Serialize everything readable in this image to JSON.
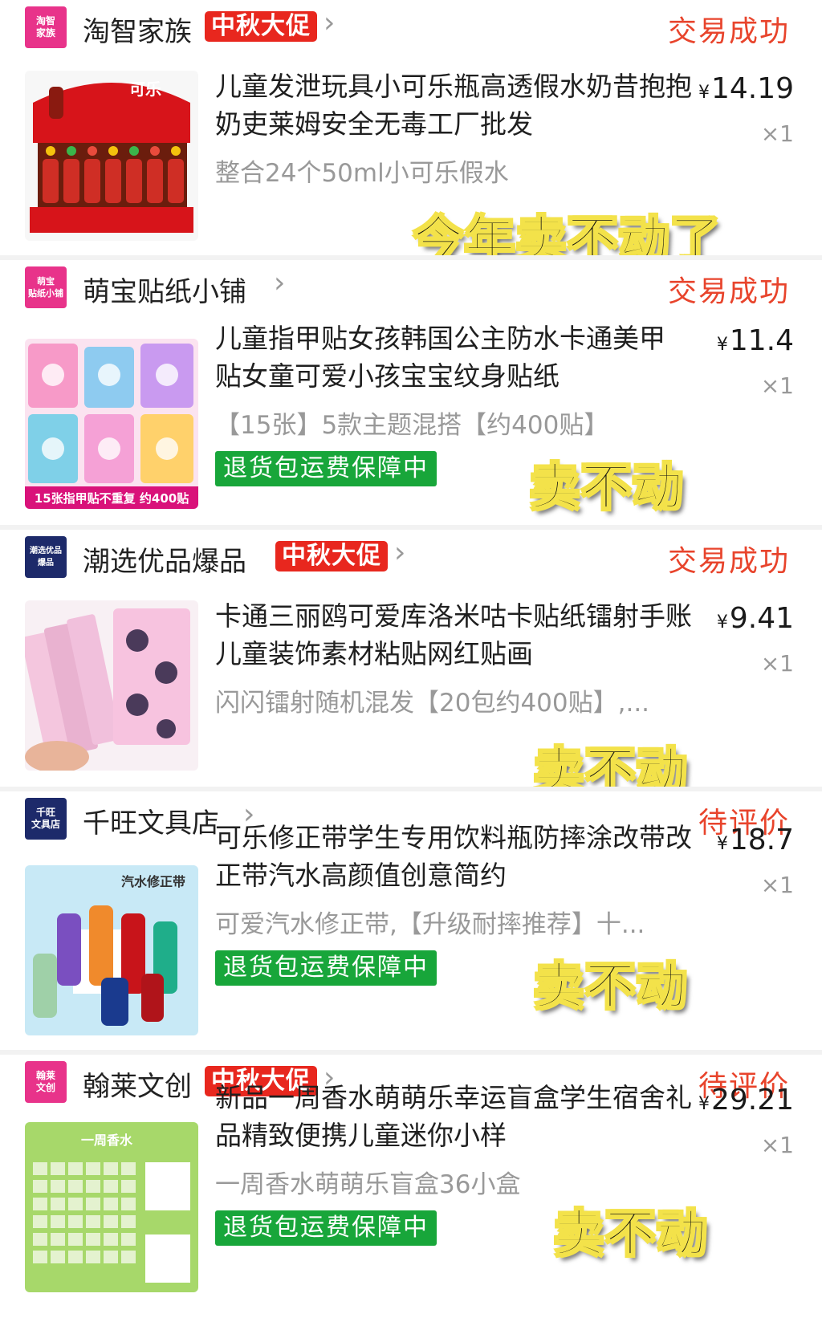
{
  "orders": [
    {
      "shop": {
        "name": "淘智家族",
        "logo_text": "淘智\n家族",
        "logo_color": "#e8338a"
      },
      "promo": "中秋大促",
      "status": "交易成功",
      "title": "儿童发泄玩具小可乐瓶高透假水奶昔抱抱奶吏莱姆安全无毒工厂批发",
      "price_currency": "¥",
      "price": "14.19",
      "qty": "×1",
      "spec": "整合24个50ml小可乐假水",
      "badge": "",
      "overlay": "今年卖不动了",
      "thumb_caption": ""
    },
    {
      "shop": {
        "name": "萌宝贴纸小铺",
        "logo_text": "萌宝\n贴纸小铺",
        "logo_color": "#e8338a"
      },
      "promo": "",
      "status": "交易成功",
      "title": "儿童指甲贴女孩韩国公主防水卡通美甲贴女童可爱小孩宝宝纹身贴纸",
      "price_currency": "¥",
      "price": "11.4",
      "qty": "×1",
      "spec": "【15张】5款主题混搭【约400贴】",
      "badge": "退货包运费保障中",
      "overlay": "卖不动",
      "thumb_caption": "15张指甲贴不重复 约400贴"
    },
    {
      "shop": {
        "name": "潮选优品爆品",
        "logo_text": "潮选优品\n爆品",
        "logo_color": "#1d2a6a"
      },
      "promo": "中秋大促",
      "status": "交易成功",
      "title": "卡通三丽鸥可爱库洛米咕卡贴纸镭射手账儿童装饰素材粘贴网红贴画",
      "price_currency": "¥",
      "price": "9.41",
      "qty": "×1",
      "spec": "闪闪镭射随机混发【20包约400贴】,...",
      "badge": "",
      "overlay": "卖不动",
      "thumb_caption": ""
    },
    {
      "shop": {
        "name": "千旺文具店",
        "logo_text": "千旺\n文具店",
        "logo_color": "#1d2a6a"
      },
      "promo": "",
      "status": "待评价",
      "title": "可乐修正带学生专用饮料瓶防摔涂改带改正带汽水高颜值创意简约",
      "price_currency": "¥",
      "price": "18.7",
      "qty": "×1",
      "spec": "可爱汽水修正带,【升级耐摔推荐】十...",
      "badge": "退货包运费保障中",
      "overlay": "卖不动",
      "thumb_caption": "汽水修正带"
    },
    {
      "shop": {
        "name": "翰莱文创",
        "logo_text": "翰莱\n文创",
        "logo_color": "#e8338a"
      },
      "promo": "中秋大促",
      "status": "待评价",
      "title": "新品一周香水萌萌乐幸运盲盒学生宿舍礼品精致便携儿童迷你小样",
      "price_currency": "¥",
      "price": "29.21",
      "qty": "×1",
      "spec": "一周香水萌萌乐盲盒36小盒",
      "badge": "退货包运费保障中",
      "overlay": "卖不动",
      "thumb_caption": "一周香水"
    }
  ]
}
